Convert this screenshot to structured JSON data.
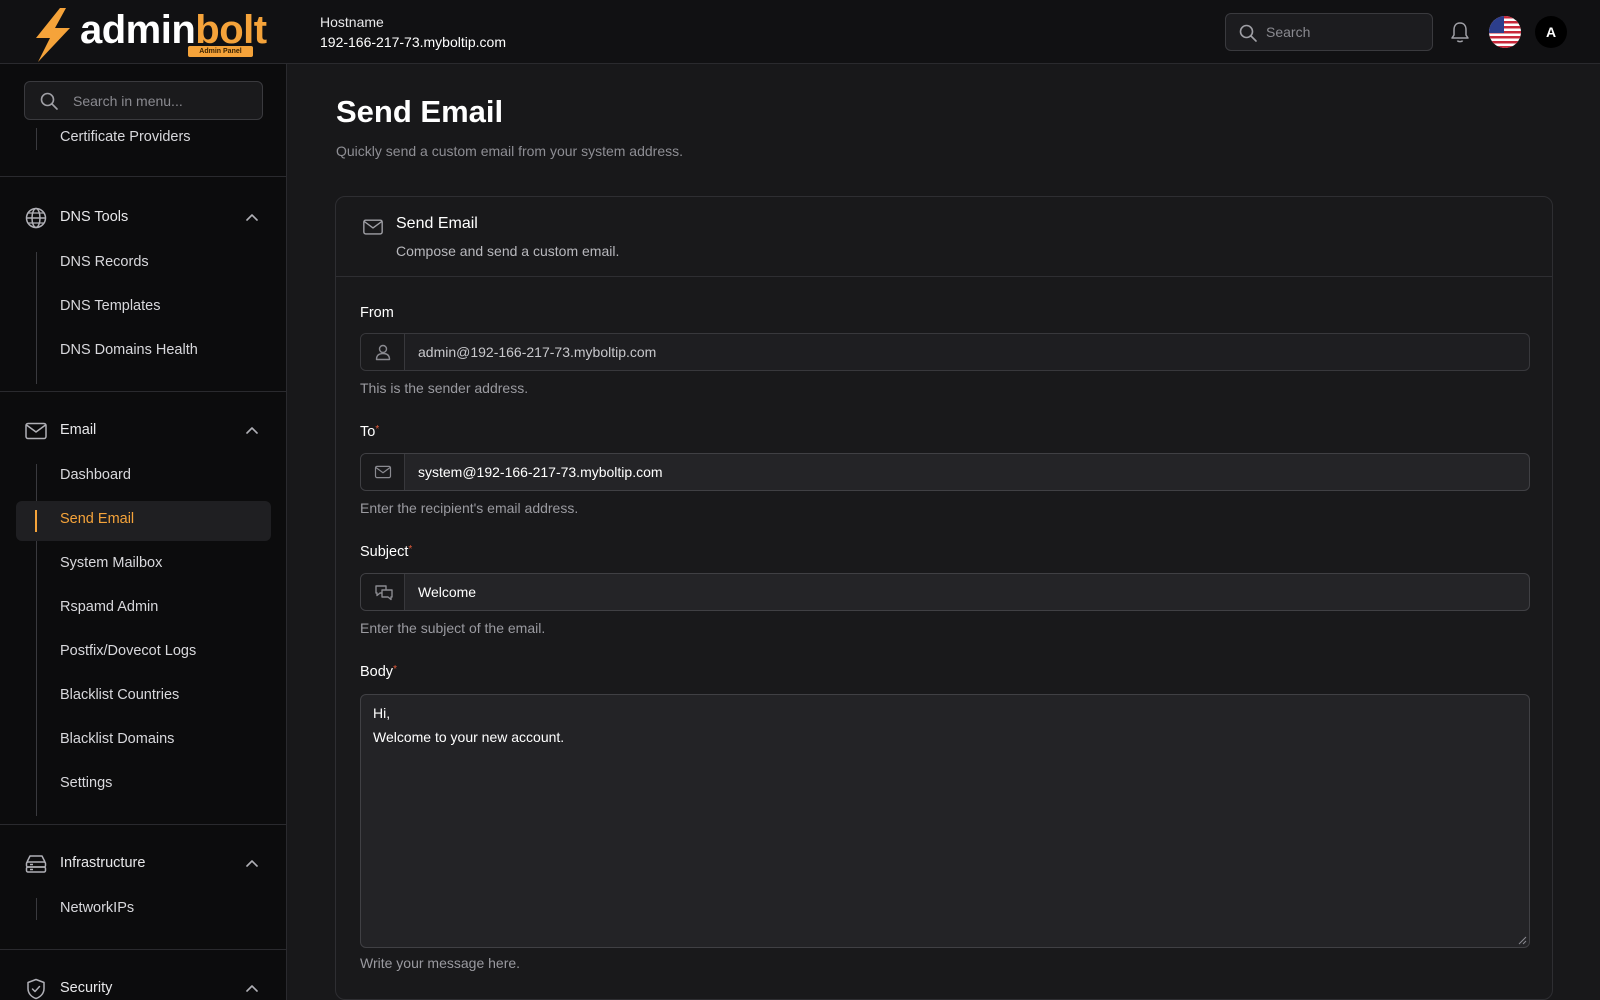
{
  "app": {
    "logo_word_white": "admin",
    "logo_word_orange": "bolt",
    "logo_badge": "Admin Panel",
    "accent_color": "#f5a33a"
  },
  "header": {
    "hostname_label": "Hostname",
    "hostname_value": "192-166-217-73.myboltip.com",
    "search_placeholder": "Search",
    "avatar_initial": "A"
  },
  "sidebar": {
    "search_placeholder": "Search in menu...",
    "partial_item": "Certificate Providers",
    "sections": [
      {
        "label": "DNS Tools",
        "icon": "globe-icon",
        "items": [
          "DNS Records",
          "DNS Templates",
          "DNS Domains Health"
        ]
      },
      {
        "label": "Email",
        "icon": "mail-icon",
        "items": [
          "Dashboard",
          "Send Email",
          "System Mailbox",
          "Rspamd Admin",
          "Postfix/Dovecot Logs",
          "Blacklist Countries",
          "Blacklist Domains",
          "Settings"
        ],
        "active_item": "Send Email"
      },
      {
        "label": "Infrastructure",
        "icon": "server-icon",
        "items": [
          "NetworkIPs"
        ]
      },
      {
        "label": "Security",
        "icon": "shield-icon",
        "items": []
      }
    ]
  },
  "main": {
    "title": "Send Email",
    "subtitle": "Quickly send a custom email from your system address.",
    "card": {
      "title": "Send Email",
      "subtitle": "Compose and send a custom email.",
      "from": {
        "label": "From",
        "value": "admin@192-166-217-73.myboltip.com",
        "help": "This is the sender address."
      },
      "to": {
        "label": "To",
        "required_mark": "*",
        "value": "system@192-166-217-73.myboltip.com",
        "help": "Enter the recipient's email address."
      },
      "subject": {
        "label": "Subject",
        "required_mark": "*",
        "value": "Welcome",
        "help": "Enter the subject of the email."
      },
      "body": {
        "label": "Body",
        "required_mark": "*",
        "line1": "Hi,",
        "line2": "Welcome to your new account.",
        "help": "Write your message here."
      }
    }
  }
}
